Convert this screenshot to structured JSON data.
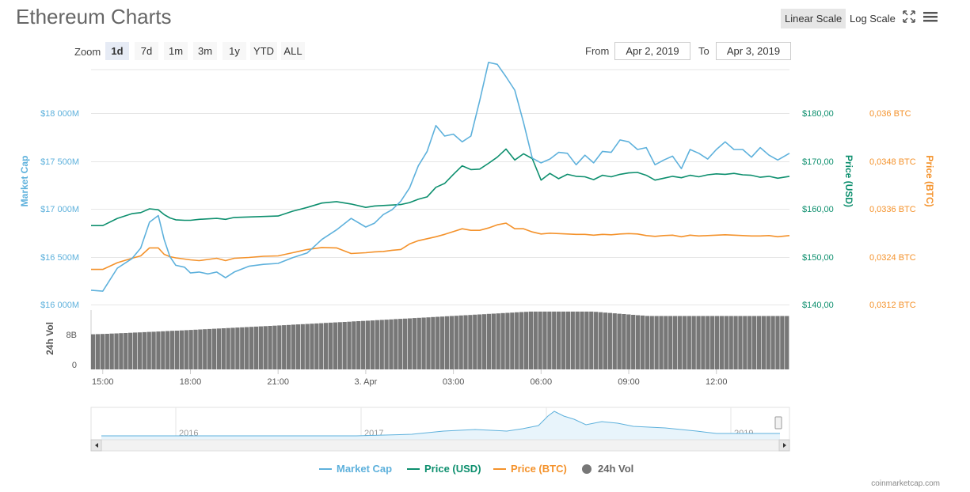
{
  "header": {
    "title": "Ethereum Charts",
    "linear_scale": "Linear Scale",
    "log_scale": "Log Scale"
  },
  "zoom": {
    "label": "Zoom",
    "buttons": [
      "1d",
      "7d",
      "1m",
      "3m",
      "1y",
      "YTD",
      "ALL"
    ],
    "selected": "1d"
  },
  "range": {
    "from_label": "From",
    "from_value": "Apr 2, 2019",
    "to_label": "To",
    "to_value": "Apr 3, 2019"
  },
  "legend": {
    "market_cap": "Market Cap",
    "price_usd": "Price (USD)",
    "price_btc": "Price (BTC)",
    "vol": "24h Vol"
  },
  "credit": "coinmarketcap.com",
  "colors": {
    "market_cap": "#5eb1dc",
    "price_usd": "#0d8f6e",
    "price_btc": "#f4922b",
    "vol": "#777777"
  },
  "icons": [
    "fullscreen-icon",
    "menu-icon"
  ],
  "chart_data": [
    {
      "type": "line",
      "x_tick_labels": [
        "15:00",
        "18:00",
        "21:00",
        "3. Apr",
        "03:00",
        "06:00",
        "09:00",
        "12:00"
      ],
      "x_range_hours": [
        14.6,
        38.5
      ],
      "axes": {
        "market_cap": {
          "label": "Market Cap",
          "ticks": [
            "$16 000M",
            "$16 500M",
            "$17 000M",
            "$17 500M",
            "$18 000M"
          ],
          "range": [
            16000,
            18500
          ]
        },
        "price_usd": {
          "label": "Price (USD)",
          "ticks": [
            "$140,00",
            "$150,00",
            "$160,00",
            "$170,00",
            "$180,00"
          ],
          "range": [
            140,
            185
          ]
        },
        "price_btc": {
          "label": "Price (BTC)",
          "ticks": [
            "0,0312 BTC",
            "0,0324 BTC",
            "0,0336 BTC",
            "0,0348 BTC",
            "0,036 BTC"
          ],
          "range_units": [
            0.0312,
            0.037
          ]
        }
      },
      "series": [
        {
          "name": "Market Cap",
          "x": [
            14.6,
            15.0,
            15.5,
            16.0,
            16.3,
            16.6,
            16.9,
            17.1,
            17.3,
            17.5,
            17.8,
            18.0,
            18.3,
            18.6,
            18.9,
            19.2,
            19.5,
            20.0,
            20.5,
            21.0,
            21.5,
            22.0,
            22.5,
            23.0,
            23.5,
            24.0,
            24.3,
            24.6,
            24.9,
            25.2,
            25.5,
            25.8,
            26.1,
            26.4,
            26.7,
            27.0,
            27.3,
            27.6,
            27.9,
            28.2,
            28.5,
            28.8,
            29.1,
            29.4,
            29.7,
            30.0,
            30.3,
            30.6,
            30.9,
            31.2,
            31.5,
            31.8,
            32.1,
            32.4,
            32.7,
            33.0,
            33.3,
            33.6,
            33.9,
            34.2,
            34.5,
            34.8,
            35.1,
            35.4,
            35.7,
            36.0,
            36.3,
            36.6,
            36.9,
            37.2,
            37.5,
            37.8,
            38.1,
            38.5
          ],
          "values": [
            16150,
            16140,
            16380,
            16480,
            16590,
            16860,
            16930,
            16680,
            16500,
            16410,
            16390,
            16330,
            16340,
            16320,
            16340,
            16280,
            16340,
            16400,
            16420,
            16430,
            16490,
            16540,
            16680,
            16780,
            16900,
            16810,
            16850,
            16940,
            16990,
            17080,
            17220,
            17450,
            17600,
            17870,
            17760,
            17780,
            17700,
            17760,
            18130,
            18530,
            18510,
            18380,
            18240,
            17900,
            17530,
            17480,
            17520,
            17590,
            17580,
            17460,
            17560,
            17480,
            17600,
            17590,
            17720,
            17700,
            17620,
            17640,
            17460,
            17510,
            17550,
            17420,
            17620,
            17580,
            17520,
            17620,
            17700,
            17620,
            17620,
            17540,
            17640,
            17560,
            17510,
            17580
          ]
        },
        {
          "name": "Price (USD)",
          "x": [
            14.6,
            15.0,
            15.5,
            16.0,
            16.3,
            16.6,
            16.9,
            17.1,
            17.3,
            17.5,
            17.8,
            18.0,
            18.3,
            18.6,
            18.9,
            19.2,
            19.5,
            20.0,
            20.5,
            21.0,
            21.5,
            22.0,
            22.5,
            23.0,
            23.5,
            24.0,
            24.3,
            24.6,
            24.9,
            25.2,
            25.5,
            25.8,
            26.1,
            26.4,
            26.7,
            27.0,
            27.3,
            27.6,
            27.9,
            28.2,
            28.5,
            28.8,
            29.1,
            29.4,
            29.7,
            30.0,
            30.3,
            30.6,
            30.9,
            31.2,
            31.5,
            31.8,
            32.1,
            32.4,
            32.7,
            33.0,
            33.3,
            33.6,
            33.9,
            34.2,
            34.5,
            34.8,
            35.1,
            35.4,
            35.7,
            36.0,
            36.3,
            36.6,
            36.9,
            37.2,
            37.5,
            37.8,
            38.1,
            38.5
          ],
          "values": [
            156.5,
            156.5,
            158.0,
            159.0,
            159.2,
            160.0,
            159.8,
            158.8,
            158.1,
            157.7,
            157.6,
            157.6,
            157.8,
            157.9,
            158.0,
            157.8,
            158.2,
            158.3,
            158.4,
            158.5,
            159.5,
            160.3,
            161.2,
            161.5,
            161.0,
            160.3,
            160.6,
            160.7,
            160.8,
            160.9,
            161.3,
            162.0,
            162.5,
            164.5,
            165.3,
            167.2,
            169.0,
            168.2,
            168.3,
            169.5,
            170.8,
            172.5,
            170.2,
            171.5,
            170.5,
            166.0,
            167.4,
            166.3,
            167.2,
            166.8,
            166.7,
            166.1,
            167.0,
            166.7,
            167.2,
            167.5,
            167.6,
            167.0,
            166.0,
            166.4,
            166.8,
            166.5,
            167.0,
            166.7,
            167.1,
            167.3,
            167.2,
            167.4,
            167.1,
            167.0,
            166.6,
            166.8,
            166.4,
            166.8
          ]
        },
        {
          "name": "Price (BTC)",
          "x": [
            14.6,
            15.0,
            15.5,
            16.0,
            16.3,
            16.6,
            16.9,
            17.1,
            17.3,
            17.5,
            17.8,
            18.0,
            18.3,
            18.6,
            18.9,
            19.2,
            19.5,
            20.0,
            20.5,
            21.0,
            21.5,
            22.0,
            22.5,
            23.0,
            23.5,
            24.0,
            24.3,
            24.6,
            24.9,
            25.2,
            25.5,
            25.8,
            26.1,
            26.4,
            26.7,
            27.0,
            27.3,
            27.6,
            27.9,
            28.2,
            28.5,
            28.8,
            29.1,
            29.4,
            29.7,
            30.0,
            30.3,
            30.6,
            30.9,
            31.2,
            31.5,
            31.8,
            32.1,
            32.4,
            32.7,
            33.0,
            33.3,
            33.6,
            33.9,
            34.2,
            34.5,
            34.8,
            35.1,
            35.4,
            35.7,
            36.0,
            36.3,
            36.6,
            36.9,
            37.2,
            37.5,
            37.8,
            38.1,
            38.5
          ],
          "values": [
            0.03208,
            0.03208,
            0.03225,
            0.03236,
            0.03242,
            0.03262,
            0.03262,
            0.03246,
            0.0324,
            0.03237,
            0.03234,
            0.03232,
            0.0323,
            0.03233,
            0.03236,
            0.0323,
            0.03236,
            0.03238,
            0.03241,
            0.03242,
            0.0325,
            0.03258,
            0.03263,
            0.03262,
            0.03248,
            0.0325,
            0.03252,
            0.03253,
            0.03256,
            0.03258,
            0.03272,
            0.0328,
            0.03285,
            0.0329,
            0.03296,
            0.03303,
            0.0331,
            0.03306,
            0.03306,
            0.03312,
            0.0332,
            0.03324,
            0.0331,
            0.0331,
            0.03302,
            0.03297,
            0.03299,
            0.03298,
            0.03297,
            0.03296,
            0.03296,
            0.03294,
            0.03296,
            0.03295,
            0.03297,
            0.03298,
            0.03297,
            0.03293,
            0.03291,
            0.03293,
            0.03294,
            0.0329,
            0.03294,
            0.03292,
            0.03293,
            0.03294,
            0.03295,
            0.03294,
            0.03293,
            0.03292,
            0.03292,
            0.03293,
            0.0329,
            0.03293
          ]
        }
      ]
    },
    {
      "type": "bar",
      "axis_label": "24h Vol",
      "ticks": [
        "0",
        "8B"
      ],
      "range_b": [
        0,
        12
      ],
      "bar_count": 150,
      "value_start_b": 7.1,
      "value_peak_b": 11.7,
      "value_end_b": 10.8
    },
    {
      "type": "area",
      "name": "navigator",
      "x_tick_labels": [
        "2016",
        "2017",
        "2018",
        "2019"
      ]
    }
  ]
}
